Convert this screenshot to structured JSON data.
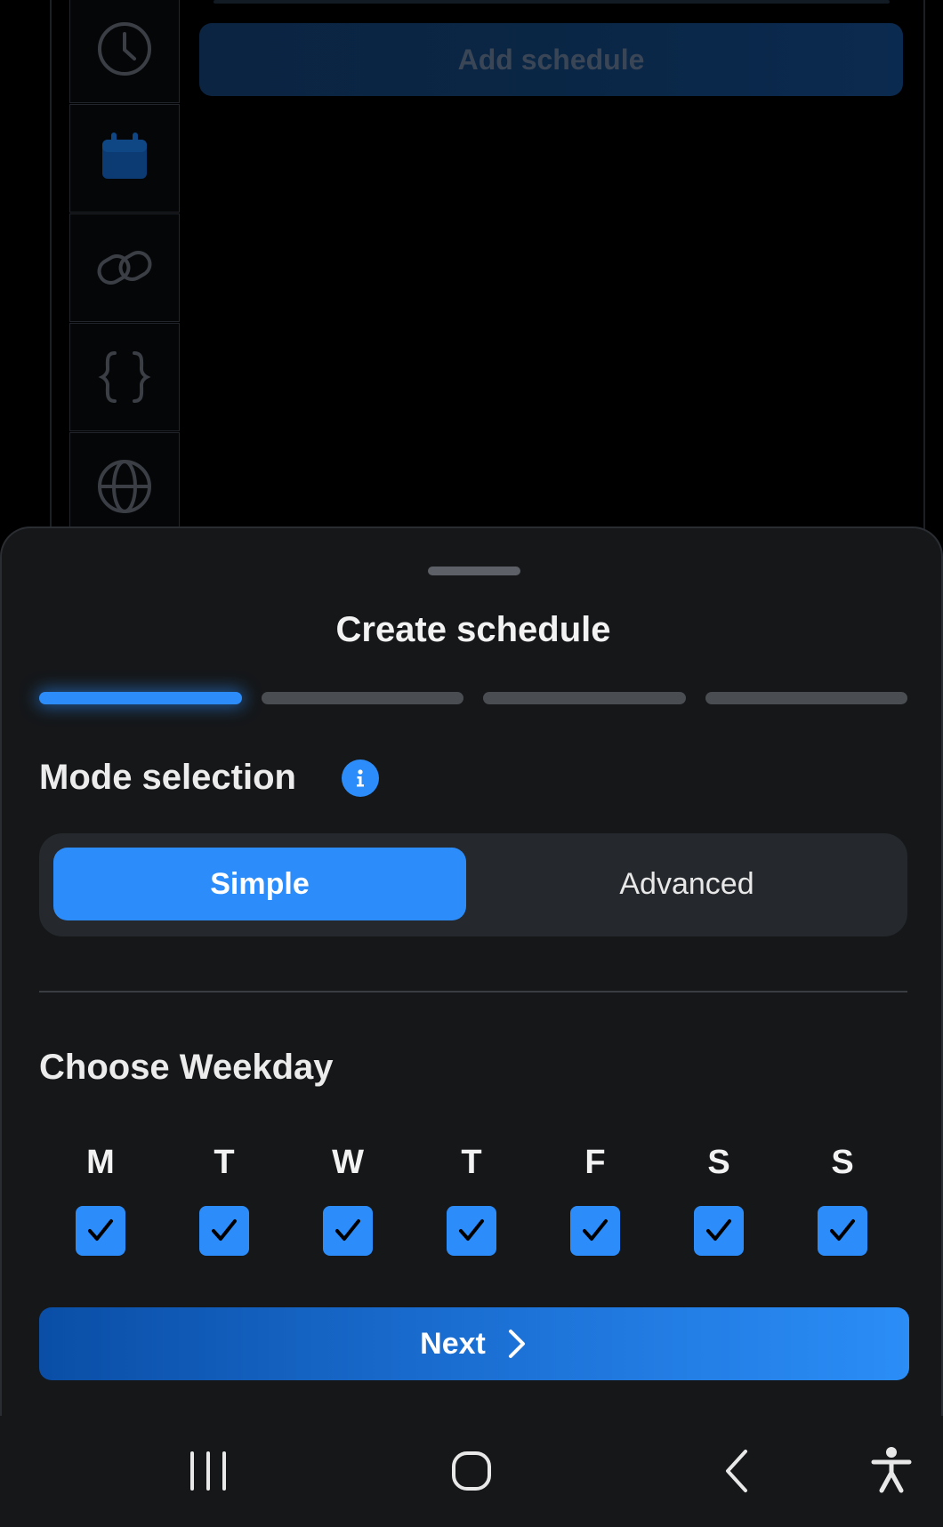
{
  "background": {
    "add_schedule_label": "Add schedule",
    "sidebar_icons": [
      "clock-icon",
      "calendar-icon",
      "link-icon",
      "braces-icon",
      "globe-icon"
    ]
  },
  "sheet": {
    "title": "Create schedule",
    "steps": {
      "total": 4,
      "current": 1
    },
    "mode": {
      "label": "Mode selection",
      "info_icon": "info-icon",
      "options": [
        "Simple",
        "Advanced"
      ],
      "selected": "Simple"
    },
    "weekday": {
      "label": "Choose Weekday",
      "days": [
        {
          "letter": "M",
          "checked": true
        },
        {
          "letter": "T",
          "checked": true
        },
        {
          "letter": "W",
          "checked": true
        },
        {
          "letter": "T",
          "checked": true
        },
        {
          "letter": "F",
          "checked": true
        },
        {
          "letter": "S",
          "checked": true
        },
        {
          "letter": "S",
          "checked": true
        }
      ]
    },
    "next_label": "Next"
  },
  "navbar": {
    "icons": [
      "recent-apps-icon",
      "home-icon",
      "back-icon",
      "accessibility-icon"
    ]
  },
  "colors": {
    "accent": "#2c8dfa",
    "sheet_bg": "#151719",
    "segment_bg": "#25282c",
    "inactive_step": "#4a4d52"
  }
}
